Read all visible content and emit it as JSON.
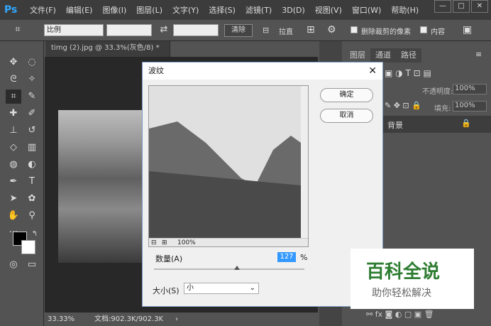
{
  "app": {
    "logo": "Ps"
  },
  "menu": [
    "文件(F)",
    "编辑(E)",
    "图像(I)",
    "图层(L)",
    "文字(Y)",
    "选择(S)",
    "滤镜(T)",
    "3D(D)",
    "视图(V)",
    "窗口(W)",
    "帮助(H)"
  ],
  "window_controls": {
    "minimize": "—",
    "maximize": "□",
    "close": "✕"
  },
  "options": {
    "ratio_value": "比例",
    "clear_label": "清除",
    "straighten_label": "拉直",
    "delete_crop_label": "删除裁剪的像素",
    "inner_label": "内容"
  },
  "document": {
    "tab_title": "timg (2).jpg @ 33.3%(灰色/8) *",
    "tab_close": "×",
    "zoom": "33.33%",
    "doc_info": "文档:902.3K/902.3K"
  },
  "panel": {
    "tabs": [
      "图层",
      "通道",
      "路径"
    ],
    "opacity_label": "不透明度:",
    "opacity_value": "100%",
    "fill_label": "填充:",
    "fill_value": "100%",
    "layer_name": "背景"
  },
  "dialog": {
    "title": "波纹",
    "ok_label": "确定",
    "cancel_label": "取消",
    "zoom": "100%",
    "amount_label": "数量(A)",
    "amount_value": "127",
    "amount_unit": "%",
    "amount_fraction": 0.55,
    "size_label": "大小(S)",
    "size_value": "小"
  },
  "watermark": {
    "brand": "百科全说",
    "tagline": "助你轻松解决"
  }
}
